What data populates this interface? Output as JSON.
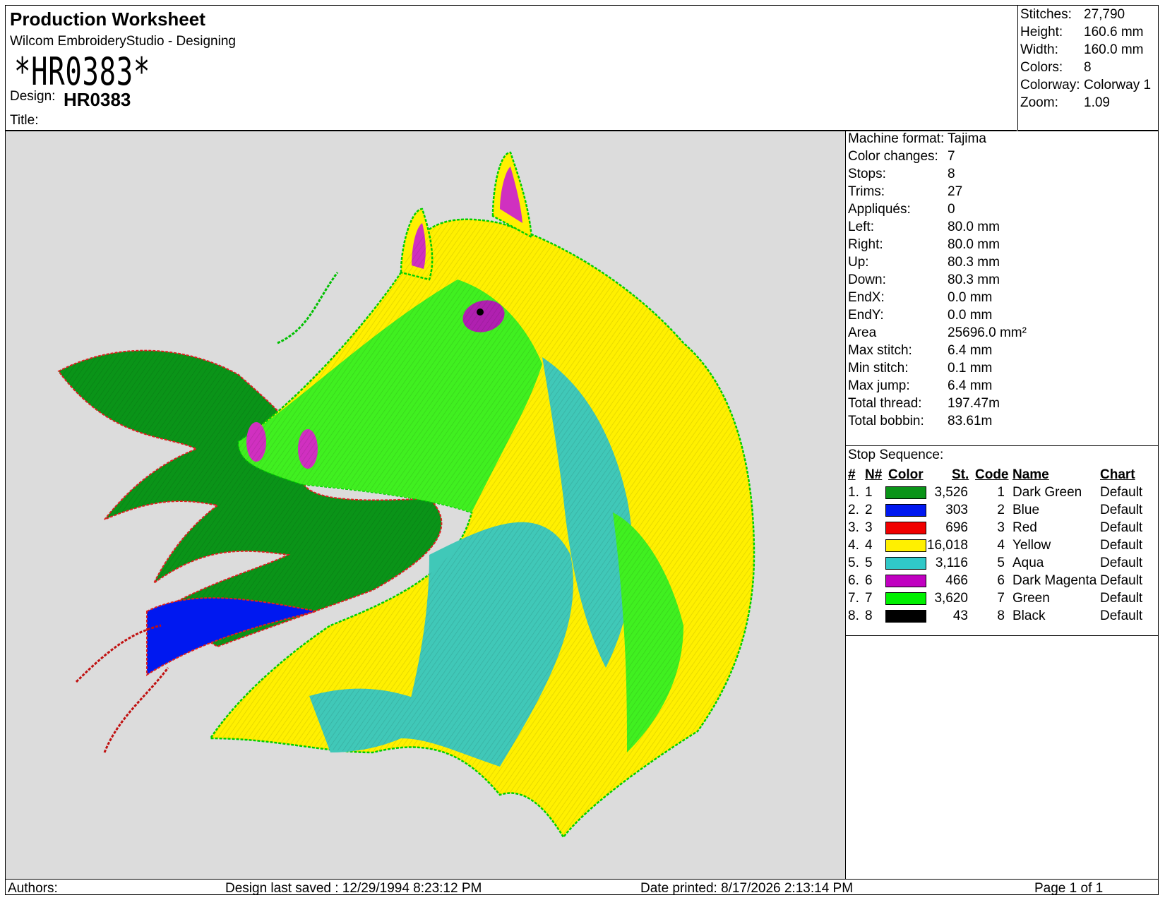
{
  "header": {
    "title": "Production Worksheet",
    "subtitle": "Wilcom EmbroideryStudio - Designing",
    "code_banner": "*HR0383*",
    "design_label": "Design:",
    "design_value": "HR0383",
    "title_label": "Title:"
  },
  "summary": [
    {
      "label": "Stitches:",
      "value": "27,790"
    },
    {
      "label": "Height:",
      "value": "160.6 mm"
    },
    {
      "label": "Width:",
      "value": "160.0 mm"
    },
    {
      "label": "Colors:",
      "value": "8"
    },
    {
      "label": "Colorway:",
      "value": "Colorway 1"
    },
    {
      "label": "Zoom:",
      "value": "1.09"
    }
  ],
  "stats": [
    {
      "label": "Machine format:",
      "value": "Tajima"
    },
    {
      "label": "Color changes:",
      "value": "7"
    },
    {
      "label": "Stops:",
      "value": "8"
    },
    {
      "label": "Trims:",
      "value": "27"
    },
    {
      "label": "Appliqués:",
      "value": "0"
    },
    {
      "label": "Left:",
      "value": "80.0 mm"
    },
    {
      "label": "Right:",
      "value": "80.0 mm"
    },
    {
      "label": "Up:",
      "value": "80.3 mm"
    },
    {
      "label": "Down:",
      "value": "80.3 mm"
    },
    {
      "label": "EndX:",
      "value": "0.0 mm"
    },
    {
      "label": "EndY:",
      "value": "0.0 mm"
    },
    {
      "label": "Area",
      "value": "25696.0 mm²"
    },
    {
      "label": "Max stitch:",
      "value": "6.4 mm"
    },
    {
      "label": "Min stitch:",
      "value": "0.1 mm"
    },
    {
      "label": "Max jump:",
      "value": "6.4 mm"
    },
    {
      "label": "Total thread:",
      "value": "197.47m"
    },
    {
      "label": "Total bobbin:",
      "value": "83.61m"
    }
  ],
  "stop_sequence": {
    "title": "Stop Sequence:",
    "headers": {
      "num": "#",
      "n": "N#",
      "color": "Color",
      "st": "St.",
      "code": "Code",
      "name": "Name",
      "chart": "Chart"
    },
    "rows": [
      {
        "num": "1.",
        "n": "1",
        "hex": "#0a9418",
        "st": "3,526",
        "code": "1",
        "name": "Dark Green",
        "chart": "Default"
      },
      {
        "num": "2.",
        "n": "2",
        "hex": "#0018f0",
        "st": "303",
        "code": "2",
        "name": "Blue",
        "chart": "Default"
      },
      {
        "num": "3.",
        "n": "3",
        "hex": "#f00000",
        "st": "696",
        "code": "3",
        "name": "Red",
        "chart": "Default"
      },
      {
        "num": "4.",
        "n": "4",
        "hex": "#fff000",
        "st": "16,018",
        "code": "4",
        "name": "Yellow",
        "chart": "Default"
      },
      {
        "num": "5.",
        "n": "5",
        "hex": "#30c8c8",
        "st": "3,116",
        "code": "5",
        "name": "Aqua",
        "chart": "Default"
      },
      {
        "num": "6.",
        "n": "6",
        "hex": "#c000c0",
        "st": "466",
        "code": "6",
        "name": "Dark Magenta",
        "chart": "Default"
      },
      {
        "num": "7.",
        "n": "7",
        "hex": "#00f000",
        "st": "3,620",
        "code": "7",
        "name": "Green",
        "chart": "Default"
      },
      {
        "num": "8.",
        "n": "8",
        "hex": "#000000",
        "st": "43",
        "code": "8",
        "name": "Black",
        "chart": "Default"
      }
    ]
  },
  "footer": {
    "authors": "Authors:",
    "saved": "Design last saved : 12/29/1994 8:23:12 PM",
    "printed": "Date printed: 8/17/2026 2:13:14 PM",
    "page": "Page 1 of 1"
  },
  "colors": {
    "canvas_bg": "#dcdcdc"
  }
}
